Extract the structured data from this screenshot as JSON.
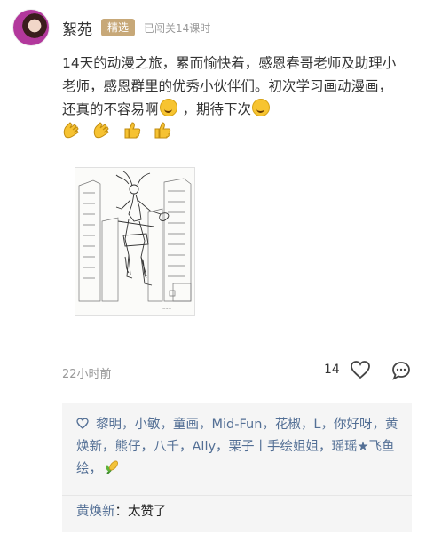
{
  "post": {
    "username": "絮苑",
    "badge": "精选",
    "meta": "已闯关14课时",
    "text_part1": "14天的动漫之旅，累而愉快着，感恩春哥老师及助理小老师，感恩群里的优秀小伙伴们。初次学习画动漫画，还真的不容易啊",
    "text_part2": "，期待下次",
    "time": "22小时前",
    "like_count": "14"
  },
  "icons": {
    "avatar": "avatar",
    "emoji": "grinning-face-icon",
    "smile": "smiling-face-icon",
    "hands": [
      "clapping-hands-icon",
      "clapping-hands-icon",
      "thumbs-up-icon",
      "thumbs-up-icon"
    ],
    "like": "heart-icon",
    "comment": "comment-bubble-icon"
  },
  "likes": {
    "names": "黎明，小敏，童画，Mid-Fun，花椒，L，你好呀，黄焕新，熊仔，八千，Ally，栗子丨手绘姐姐，瑶瑶★飞鱼绘，"
  },
  "comments": [
    {
      "author": "黄焕新",
      "separator": "：",
      "text": "太赞了"
    }
  ],
  "colors": {
    "badge": "#c7a878",
    "link": "#536f95",
    "panel": "#f5f5f5"
  }
}
